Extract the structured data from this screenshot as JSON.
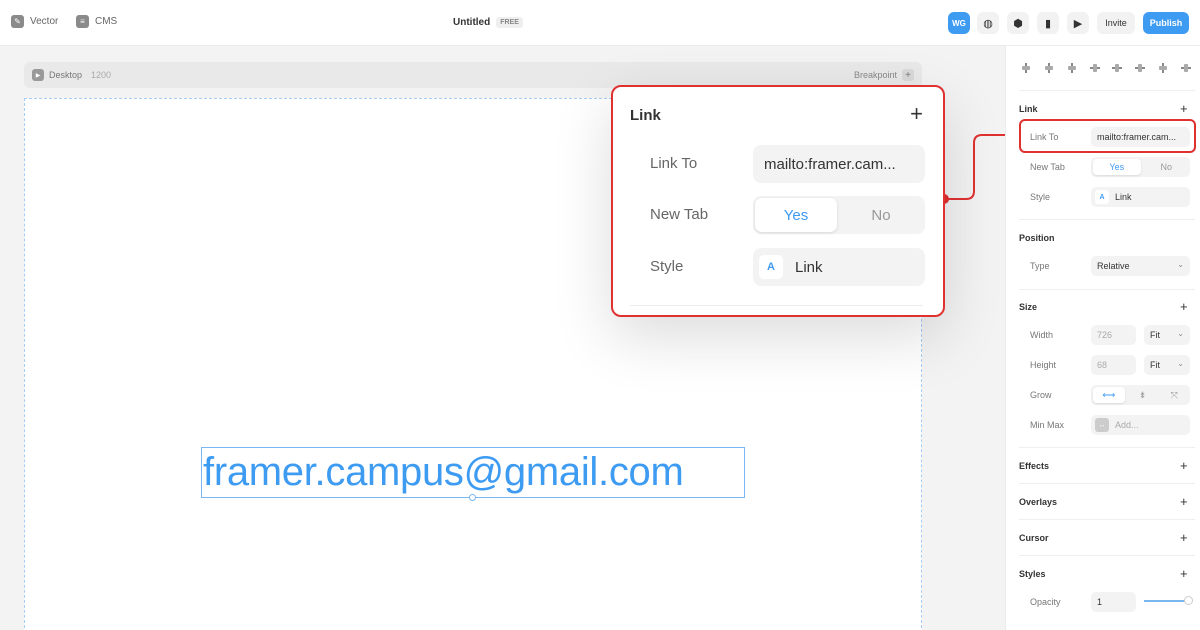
{
  "topbar": {
    "vector_label": "Vector",
    "cms_label": "CMS",
    "title": "Untitled",
    "badge": "FREE",
    "avatar_initials": "WG",
    "invite_label": "Invite",
    "publish_label": "Publish"
  },
  "canvas": {
    "breakpoint_name": "Desktop",
    "breakpoint_width": "1200",
    "breakpoint_button": "Breakpoint",
    "email_text": "framer.campus@gmail.com"
  },
  "popup": {
    "title": "Link",
    "link_to_label": "Link To",
    "link_to_value": "mailto:framer.cam...",
    "new_tab_label": "New Tab",
    "new_tab_yes": "Yes",
    "new_tab_no": "No",
    "style_label": "Style",
    "style_icon": "A",
    "style_value": "Link"
  },
  "panel": {
    "link": {
      "title": "Link",
      "link_to_label": "Link To",
      "link_to_value": "mailto:framer.cam...",
      "new_tab_label": "New Tab",
      "yes": "Yes",
      "no": "No",
      "style_label": "Style",
      "style_icon": "A",
      "style_value": "Link"
    },
    "position": {
      "title": "Position",
      "type_label": "Type",
      "type_value": "Relative"
    },
    "size": {
      "title": "Size",
      "width_label": "Width",
      "width_value": "726",
      "width_mode": "Fit",
      "height_label": "Height",
      "height_value": "68",
      "height_mode": "Fit",
      "grow_label": "Grow",
      "minmax_label": "Min Max",
      "minmax_value": "Add..."
    },
    "effects_title": "Effects",
    "overlays_title": "Overlays",
    "cursor_title": "Cursor",
    "styles": {
      "title": "Styles",
      "opacity_label": "Opacity",
      "opacity_value": "1",
      "opacity_level": 1
    }
  },
  "colors": {
    "accent": "#3e9bf2",
    "highlight": "#e03131"
  }
}
